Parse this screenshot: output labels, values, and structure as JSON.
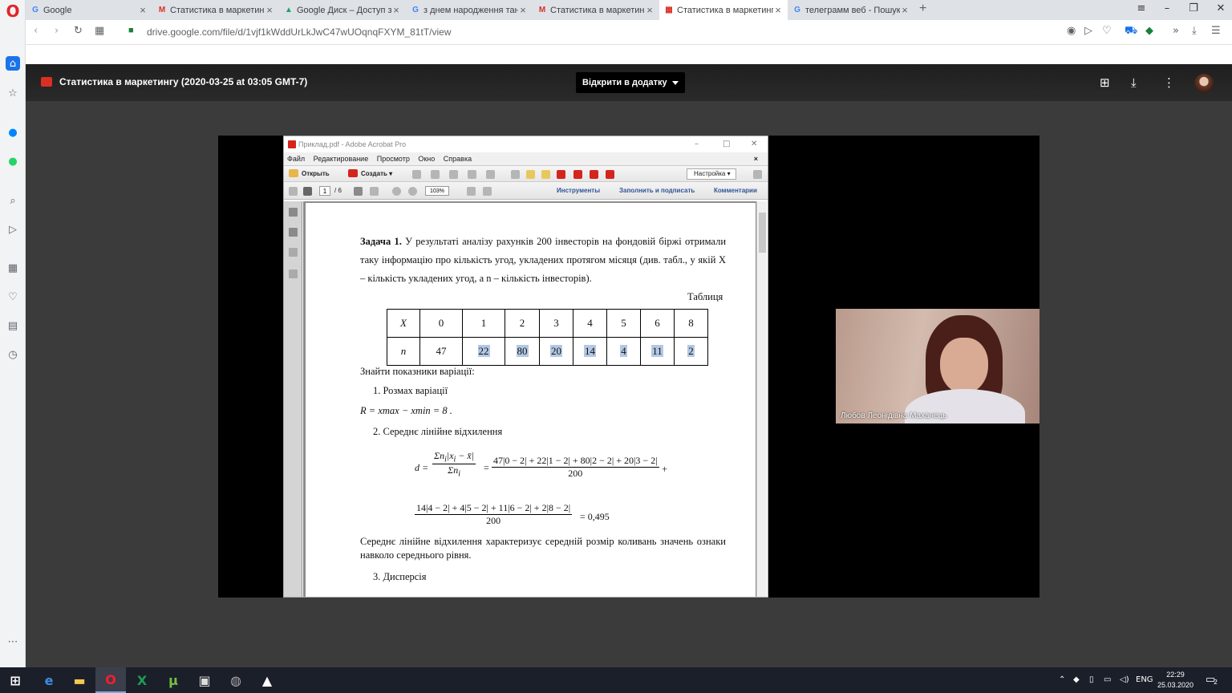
{
  "browser": {
    "tabs": [
      {
        "label": "Google",
        "favicon": "G",
        "color": "#4285f4"
      },
      {
        "label": "Статистика в маркетингу",
        "favicon": "M",
        "color": "#d93025"
      },
      {
        "label": "Google Диск – Доступ заб",
        "favicon": "▲",
        "color": "#1fa463"
      },
      {
        "label": "з днем народження танц",
        "favicon": "G",
        "color": "#4285f4"
      },
      {
        "label": "Статистика в маркетингу",
        "favicon": "M",
        "color": "#d93025"
      },
      {
        "label": "Статистика в маркетингу",
        "favicon": "▦",
        "color": "#d93025"
      },
      {
        "label": "телеграмм веб - Пошук G",
        "favicon": "G",
        "color": "#4285f4"
      }
    ],
    "url": "drive.google.com/file/d/1vjf1kWddUrLkJwC47wUOqnqFXYM_81tT/view"
  },
  "viewer": {
    "title": "Статистика в маркетингу (2020-03-25 at 03:05 GMT-7)",
    "open_with": "Відкрити в додатку"
  },
  "acrobat": {
    "window_title": "Приклад.pdf - Adobe Acrobat Pro",
    "menu": [
      "Файл",
      "Редактирование",
      "Просмотр",
      "Окно",
      "Справка"
    ],
    "open_label": "Открыть",
    "create_label": "Создать",
    "settings_label": "Настройка",
    "page_current": "1",
    "page_total": "/ 6",
    "zoom": "103%",
    "links": [
      "Инструменты",
      "Заполнить и подписать",
      "Комментарии"
    ]
  },
  "document": {
    "task_label": "Задача 1.",
    "task_text": "У результаті аналізу рахунків 200 інвесторів на фондовій біржі отримали таку інформацію про кількість угод, укладених протягом місяця (див. табл., у якій X – кількість укладених угод, а n – кількість інвесторів).",
    "table_caption": "Таблиця",
    "table": {
      "x_label": "X",
      "n_label": "n",
      "x_values": [
        "0",
        "1",
        "2",
        "3",
        "4",
        "5",
        "6",
        "8"
      ],
      "n_values": [
        "47",
        "22",
        "80",
        "20",
        "14",
        "4",
        "11",
        "2"
      ]
    },
    "find_text": "Знайти показники варіації:",
    "item1": "1.  Розмах варіації",
    "range_formula": "R = xmax − xmin = 8 .",
    "item2": "2.  Середнє лінійне відхилення",
    "d_num": "47|0 − 2| + 22|1 − 2| + 80|2 − 2| + 20|3 − 2|",
    "d_den": "200",
    "d_num2": "14|4 − 2| + 4|5 − 2| + 11|6 − 2| + 2|8 − 2|",
    "d_den2": "200",
    "d_result": "= 0,495",
    "explain": "Середнє лінійне відхилення характеризує середній розмір коливань значень ознаки навколо середнього рівня.",
    "item3": "3.  Дисперсія"
  },
  "participant": {
    "name": "Любов Леонідівна Маханець"
  },
  "taskbar": {
    "lang": "ENG",
    "time": "22:29",
    "date": "25.03.2020",
    "notif": "2"
  }
}
